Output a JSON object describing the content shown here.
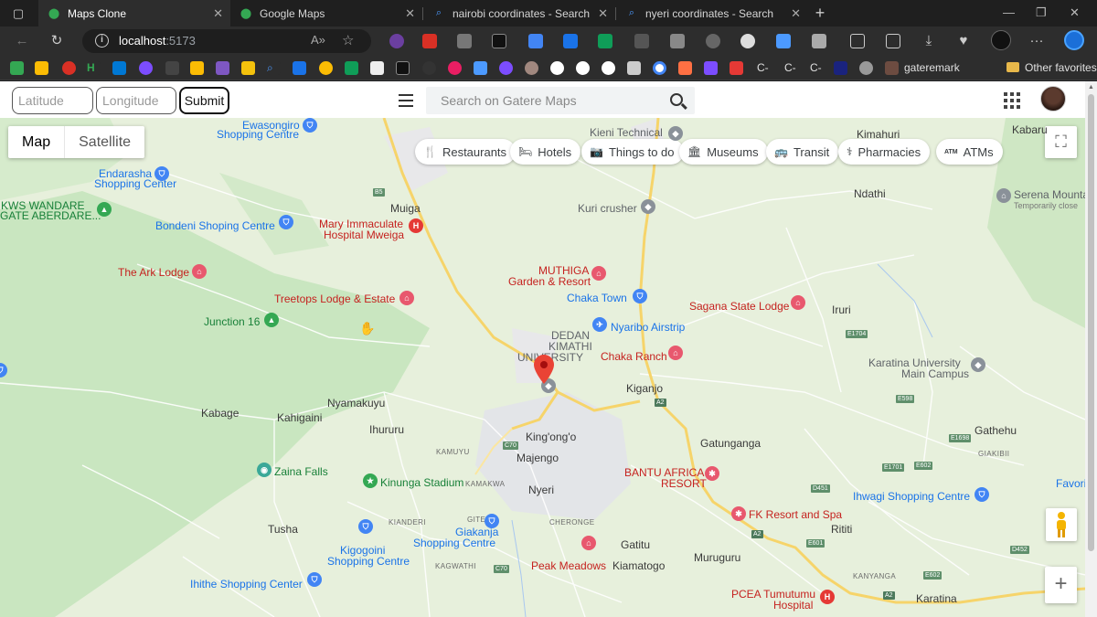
{
  "browser": {
    "tabs": [
      {
        "title": "Maps Clone",
        "active": true
      },
      {
        "title": "Google Maps",
        "active": false
      },
      {
        "title": "nairobi coordinates - Search",
        "active": false
      },
      {
        "title": "nyeri coordinates - Search",
        "active": false
      }
    ],
    "new_tab_label": "+",
    "url_host": "localhost",
    "url_port": ":5173",
    "bookmarks_user": "gateremark",
    "bookmarks_other": "Other favorites"
  },
  "app": {
    "latitude_placeholder": "Latitude",
    "longitude_placeholder": "Longitude",
    "submit_label": "Submit",
    "search_placeholder": "Search on Gatere Maps"
  },
  "map": {
    "type_options": [
      "Map",
      "Satellite"
    ],
    "selected_type": "Map",
    "categories": [
      {
        "label": "Restaurants",
        "icon": "fork-knife-icon"
      },
      {
        "label": "Hotels",
        "icon": "bed-icon"
      },
      {
        "label": "Things to do",
        "icon": "camera-icon"
      },
      {
        "label": "Museums",
        "icon": "museum-icon"
      },
      {
        "label": "Transit",
        "icon": "bus-icon"
      },
      {
        "label": "Pharmacies",
        "icon": "pharmacy-icon"
      },
      {
        "label": "ATMs",
        "icon": "atm-icon"
      }
    ],
    "zoom_in": "+",
    "places": {
      "ewasongiro": "Ewasongiro",
      "ewasongiro2": "Shopping Centre",
      "endarasha": "Endarasha",
      "endarasha2": "Shopping Center",
      "kws": "KWS WANDARE",
      "kws2": "GATE ABERDARE...",
      "bondeni": "Bondeni Shoping Centre",
      "ark": "The Ark Lodge",
      "treetops": "Treetops Lodge & Estate",
      "junction": "Junction 16",
      "muiga": "Muiga",
      "mary": "Mary Immaculate",
      "mary2": "Hospital Mweiga",
      "kieni": "Kieni Technical",
      "kuri": "Kuri crusher",
      "muthiga": "MUTHIGA",
      "muthiga2": "Garden & Resort",
      "chaka_town": "Chaka Town",
      "nyaribo": "Nyaribo Airstrip",
      "dedan": "DEDAN",
      "dedan2": "KIMATHI",
      "dedan3": "UNIVERSITY",
      "chaka_ranch": "Chaka Ranch",
      "kiganjo": "Kiganjo",
      "sagana": "Sagana State Lodge",
      "kimahuri": "Kimahuri",
      "kabaru": "Kabaru",
      "ndathi": "Ndathi",
      "serena": "Serena Mounta",
      "serena2": "Temporarily close",
      "iruri": "Iruri",
      "karatina_univ": "Karatina University",
      "karatina_univ2": "Main Campus",
      "nyamakuyu": "Nyamakuyu",
      "kabage": "Kabage",
      "kahigaini": "Kahigaini",
      "ihururu": "Ihururu",
      "kingongo": "King'ong'o",
      "majengo": "Majengo",
      "kamuyu": "KAMUYU",
      "gatunganga": "Gatunganga",
      "gathehu": "Gathehu",
      "giakibii": "GIAKIBII",
      "zaina": "Zaina Falls",
      "kinunga": "Kinunga Stadium",
      "kamakwa": "KAMAKWA",
      "nyeri": "Nyeri",
      "bantu": "BANTU AFRICA",
      "bantu2": "RESORT",
      "fk": "FK Resort and Spa",
      "ihwagi": "Ihwagi Shopping Centre",
      "ititi": "Rititi",
      "tusha": "Tusha",
      "kianderi": "KIANDERI",
      "gitero": "GITERO",
      "giakanja": "Giakanja",
      "giakanja2": "Shopping Centre",
      "cheronge": "CHERONGE",
      "kigogoini": "Kigogoini",
      "kigogoini2": "Shopping Centre",
      "gatitu": "Gatitu",
      "muruguru": "Muruguru",
      "kagwathi": "KAGWATHI",
      "peak": "Peak Meadows",
      "kiamatogo": "Kiamatogo",
      "ihithe": "Ihithe Shopping Center",
      "pcea": "PCEA Tumutumu",
      "pcea2": "Hospital",
      "kanyanga": "KANYANGA",
      "karatina": "Karatina",
      "favorites": "Favorites"
    },
    "road_shields": [
      "B5",
      "E1704",
      "E598",
      "A2",
      "A2",
      "C70",
      "C70",
      "E1698",
      "E1701",
      "E602",
      "D451",
      "E601",
      "A2",
      "D452",
      "E602"
    ]
  },
  "colors": {
    "park_green": "#c9e6c0",
    "map_base": "#e7f0dc",
    "road_yellow": "#f6d46a",
    "urban_gray": "#e3e5e8",
    "marker_red": "#ea4335",
    "accent_blue": "#1a73e8"
  }
}
